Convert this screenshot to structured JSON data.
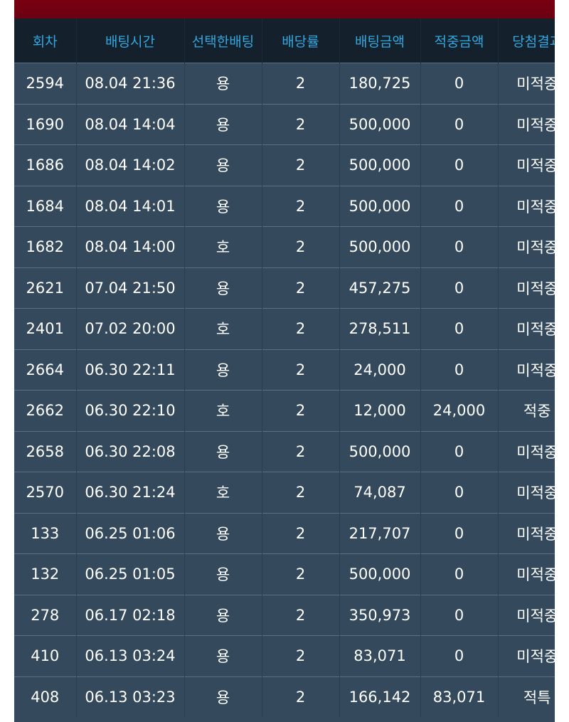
{
  "columns": [
    "회차",
    "배팅시간",
    "선택한배팅",
    "배당률",
    "배팅금액",
    "적중금액",
    "당첨결과"
  ],
  "colors": {
    "header_text": "#31a8df",
    "lose": "#e8232a",
    "win": "#1e9a2e",
    "special": "#f0a51e"
  },
  "rows": [
    {
      "round": "2594",
      "time": "08.04 21:36",
      "choice": "용",
      "odds": "2",
      "amount": "180,725",
      "win_amount": "0",
      "result": "미적중",
      "status": "lose"
    },
    {
      "round": "1690",
      "time": "08.04 14:04",
      "choice": "용",
      "odds": "2",
      "amount": "500,000",
      "win_amount": "0",
      "result": "미적중",
      "status": "lose"
    },
    {
      "round": "1686",
      "time": "08.04 14:02",
      "choice": "용",
      "odds": "2",
      "amount": "500,000",
      "win_amount": "0",
      "result": "미적중",
      "status": "lose"
    },
    {
      "round": "1684",
      "time": "08.04 14:01",
      "choice": "용",
      "odds": "2",
      "amount": "500,000",
      "win_amount": "0",
      "result": "미적중",
      "status": "lose"
    },
    {
      "round": "1682",
      "time": "08.04 14:00",
      "choice": "호",
      "odds": "2",
      "amount": "500,000",
      "win_amount": "0",
      "result": "미적중",
      "status": "lose"
    },
    {
      "round": "2621",
      "time": "07.04 21:50",
      "choice": "용",
      "odds": "2",
      "amount": "457,275",
      "win_amount": "0",
      "result": "미적중",
      "status": "lose"
    },
    {
      "round": "2401",
      "time": "07.02 20:00",
      "choice": "호",
      "odds": "2",
      "amount": "278,511",
      "win_amount": "0",
      "result": "미적중",
      "status": "lose"
    },
    {
      "round": "2664",
      "time": "06.30 22:11",
      "choice": "용",
      "odds": "2",
      "amount": "24,000",
      "win_amount": "0",
      "result": "미적중",
      "status": "lose"
    },
    {
      "round": "2662",
      "time": "06.30 22:10",
      "choice": "호",
      "odds": "2",
      "amount": "12,000",
      "win_amount": "24,000",
      "result": "적중",
      "status": "win"
    },
    {
      "round": "2658",
      "time": "06.30 22:08",
      "choice": "용",
      "odds": "2",
      "amount": "500,000",
      "win_amount": "0",
      "result": "미적중",
      "status": "lose"
    },
    {
      "round": "2570",
      "time": "06.30 21:24",
      "choice": "호",
      "odds": "2",
      "amount": "74,087",
      "win_amount": "0",
      "result": "미적중",
      "status": "lose"
    },
    {
      "round": "133",
      "time": "06.25 01:06",
      "choice": "용",
      "odds": "2",
      "amount": "217,707",
      "win_amount": "0",
      "result": "미적중",
      "status": "lose"
    },
    {
      "round": "132",
      "time": "06.25 01:05",
      "choice": "용",
      "odds": "2",
      "amount": "500,000",
      "win_amount": "0",
      "result": "미적중",
      "status": "lose"
    },
    {
      "round": "278",
      "time": "06.17 02:18",
      "choice": "용",
      "odds": "2",
      "amount": "350,973",
      "win_amount": "0",
      "result": "미적중",
      "status": "lose"
    },
    {
      "round": "410",
      "time": "06.13 03:24",
      "choice": "용",
      "odds": "2",
      "amount": "83,071",
      "win_amount": "0",
      "result": "미적중",
      "status": "lose"
    },
    {
      "round": "408",
      "time": "06.13 03:23",
      "choice": "용",
      "odds": "2",
      "amount": "166,142",
      "win_amount": "83,071",
      "result": "적특",
      "status": "special"
    }
  ]
}
